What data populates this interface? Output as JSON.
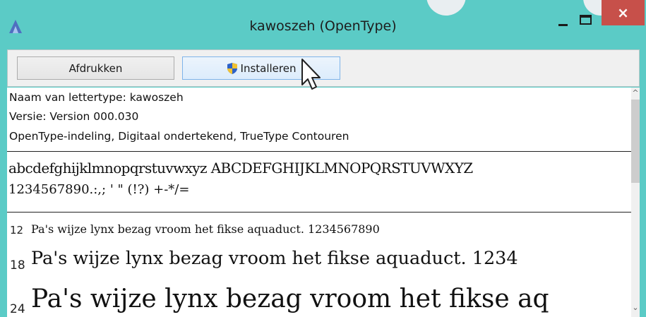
{
  "window": {
    "title": "kawoszeh (OpenType)",
    "accent_color": "#5bcbc6",
    "close_color": "#c7504a",
    "controls": {
      "minimize": "minimize-icon",
      "maximize": "maximize-icon",
      "close": "×"
    }
  },
  "toolbar": {
    "print_label": "Afdrukken",
    "install_label": "Installeren",
    "install_icon": "uac-shield-icon"
  },
  "font_info": {
    "name_line": "Naam van lettertype: kawoszeh",
    "version_line": "Versie: Version 000.030",
    "format_line": "OpenType-indeling, Digitaal ondertekend, TrueType Contouren"
  },
  "charset": {
    "line1": "abcdefghijklmnopqrstuvwxyz ABCDEFGHIJKLMNOPQRSTUVWXYZ",
    "line2": "1234567890.:,; ' \" (!?) +-*/="
  },
  "samples": [
    {
      "size": "12",
      "text": "Pa's wijze lynx bezag vroom het fikse aquaduct. 1234567890"
    },
    {
      "size": "18",
      "text": "Pa's wijze lynx bezag vroom het fikse aquaduct. 1234"
    },
    {
      "size": "24",
      "text": "Pa's wijze lynx bezag vroom het fikse aq"
    }
  ],
  "scrollbar": {
    "up": "^",
    "down": "⌄"
  }
}
